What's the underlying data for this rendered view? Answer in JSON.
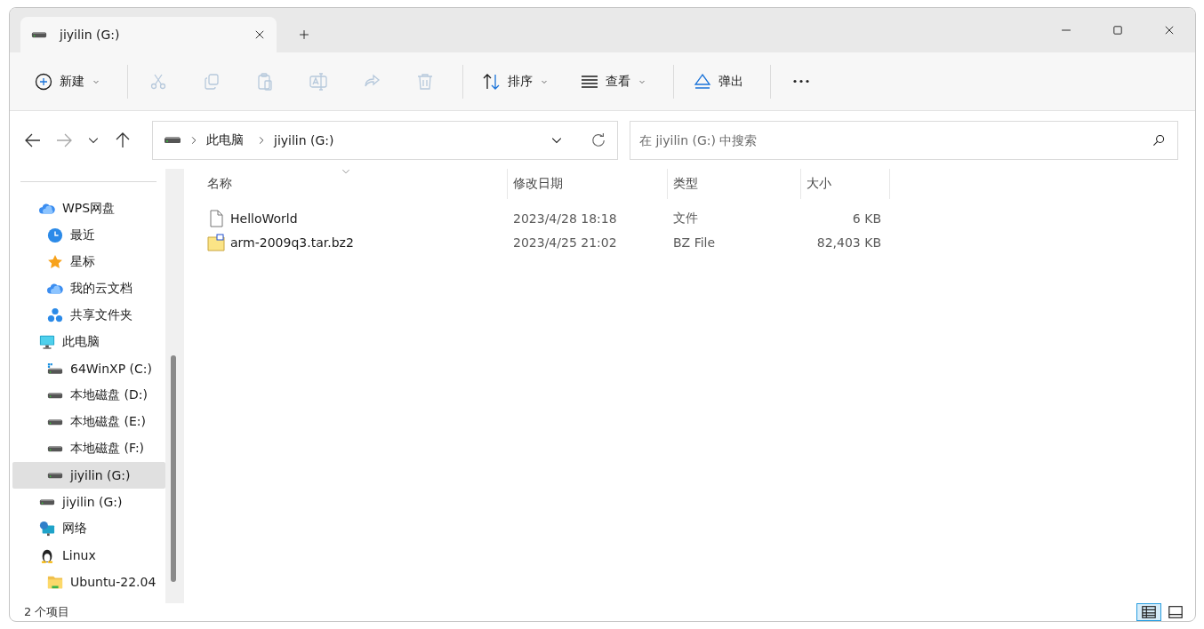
{
  "tab": {
    "title": "jiyilin (G:)"
  },
  "toolbar": {
    "groups": [
      [
        {
          "kind": "new",
          "label": "新建",
          "dropdown": true,
          "disabled": false
        }
      ],
      [
        {
          "kind": "cut",
          "disabled": true
        },
        {
          "kind": "copy",
          "disabled": true
        },
        {
          "kind": "paste",
          "disabled": true
        },
        {
          "kind": "rename",
          "disabled": true
        },
        {
          "kind": "share",
          "disabled": true
        },
        {
          "kind": "delete",
          "disabled": true
        }
      ],
      [
        {
          "kind": "sort",
          "label": "排序",
          "dropdown": true,
          "disabled": false
        },
        {
          "kind": "view",
          "label": "查看",
          "dropdown": true,
          "disabled": false
        }
      ],
      [
        {
          "kind": "eject",
          "label": "弹出",
          "dropdown": false,
          "disabled": false
        }
      ],
      [
        {
          "kind": "more",
          "disabled": false
        }
      ]
    ]
  },
  "navigation": {
    "forward_disabled": true
  },
  "address": {
    "crumbs": [
      "此电脑",
      "jiyilin (G:)"
    ]
  },
  "search": {
    "placeholder": "在 jiyilin (G:) 中搜索"
  },
  "sidebar": {
    "items": [
      {
        "kind": "cloud",
        "label": "WPS网盘",
        "selected": false,
        "children": [
          {
            "kind": "clock",
            "label": "最近",
            "selected": false
          },
          {
            "kind": "star",
            "label": "星标",
            "selected": false
          },
          {
            "kind": "cloud",
            "label": "我的云文档",
            "selected": false
          },
          {
            "kind": "nodes",
            "label": "共享文件夹",
            "selected": false
          }
        ]
      },
      {
        "kind": "monitor",
        "label": "此电脑",
        "selected": false,
        "children": [
          {
            "kind": "windrive",
            "label": "64WinXP  (C:)",
            "selected": false
          },
          {
            "kind": "drive",
            "label": "本地磁盘 (D:)",
            "selected": false
          },
          {
            "kind": "drive",
            "label": "本地磁盘 (E:)",
            "selected": false
          },
          {
            "kind": "drive",
            "label": "本地磁盘 (F:)",
            "selected": false
          },
          {
            "kind": "drive",
            "label": "jiyilin (G:)",
            "selected": true
          }
        ]
      },
      {
        "kind": "drive",
        "label": "jiyilin (G:)",
        "selected": false
      },
      {
        "kind": "network",
        "label": "网络",
        "selected": false
      },
      {
        "kind": "penguin",
        "label": "Linux",
        "selected": false,
        "children": [
          {
            "kind": "folder",
            "label": "Ubuntu-22.04",
            "selected": false
          }
        ]
      }
    ]
  },
  "table": {
    "columns": [
      "名称",
      "修改日期",
      "类型",
      "大小"
    ],
    "rows": [
      {
        "kind": "file",
        "name": "HelloWorld",
        "date": "2023/4/28 18:18",
        "type": "文件",
        "size": "6 KB"
      },
      {
        "kind": "archive",
        "name": "arm-2009q3.tar.bz2",
        "date": "2023/4/25 21:02",
        "type": "BZ File",
        "size": "82,403 KB"
      }
    ]
  },
  "status_bar": {
    "count": "2 个项目",
    "view_buttons": [
      {
        "kind": "details",
        "selected": true
      },
      {
        "kind": "tiles",
        "selected": false
      }
    ]
  }
}
